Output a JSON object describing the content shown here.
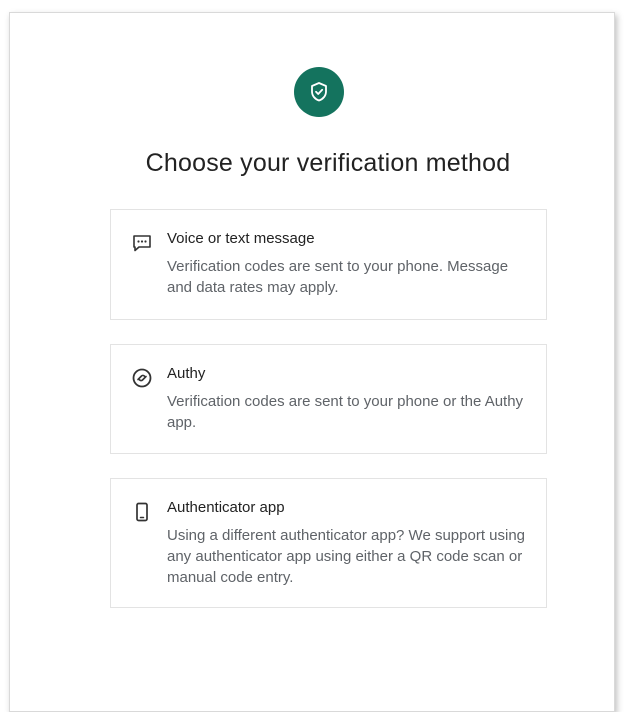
{
  "page": {
    "title": "Choose your verification method"
  },
  "options": [
    {
      "title": "Voice or text message",
      "description": "Verification codes are sent to your phone. Message and data rates may apply.",
      "icon": "message-icon"
    },
    {
      "title": "Authy",
      "description": "Verification codes are sent to your phone or the Authy app.",
      "icon": "authy-icon"
    },
    {
      "title": "Authenticator app",
      "description": "Using a different authenticator app? We support using any authenticator app using either a QR code scan or manual code entry.",
      "icon": "phone-icon"
    }
  ],
  "colors": {
    "accent": "#14735e",
    "text": "#222222",
    "muted": "#5f6368",
    "border": "#e3e3e3"
  }
}
